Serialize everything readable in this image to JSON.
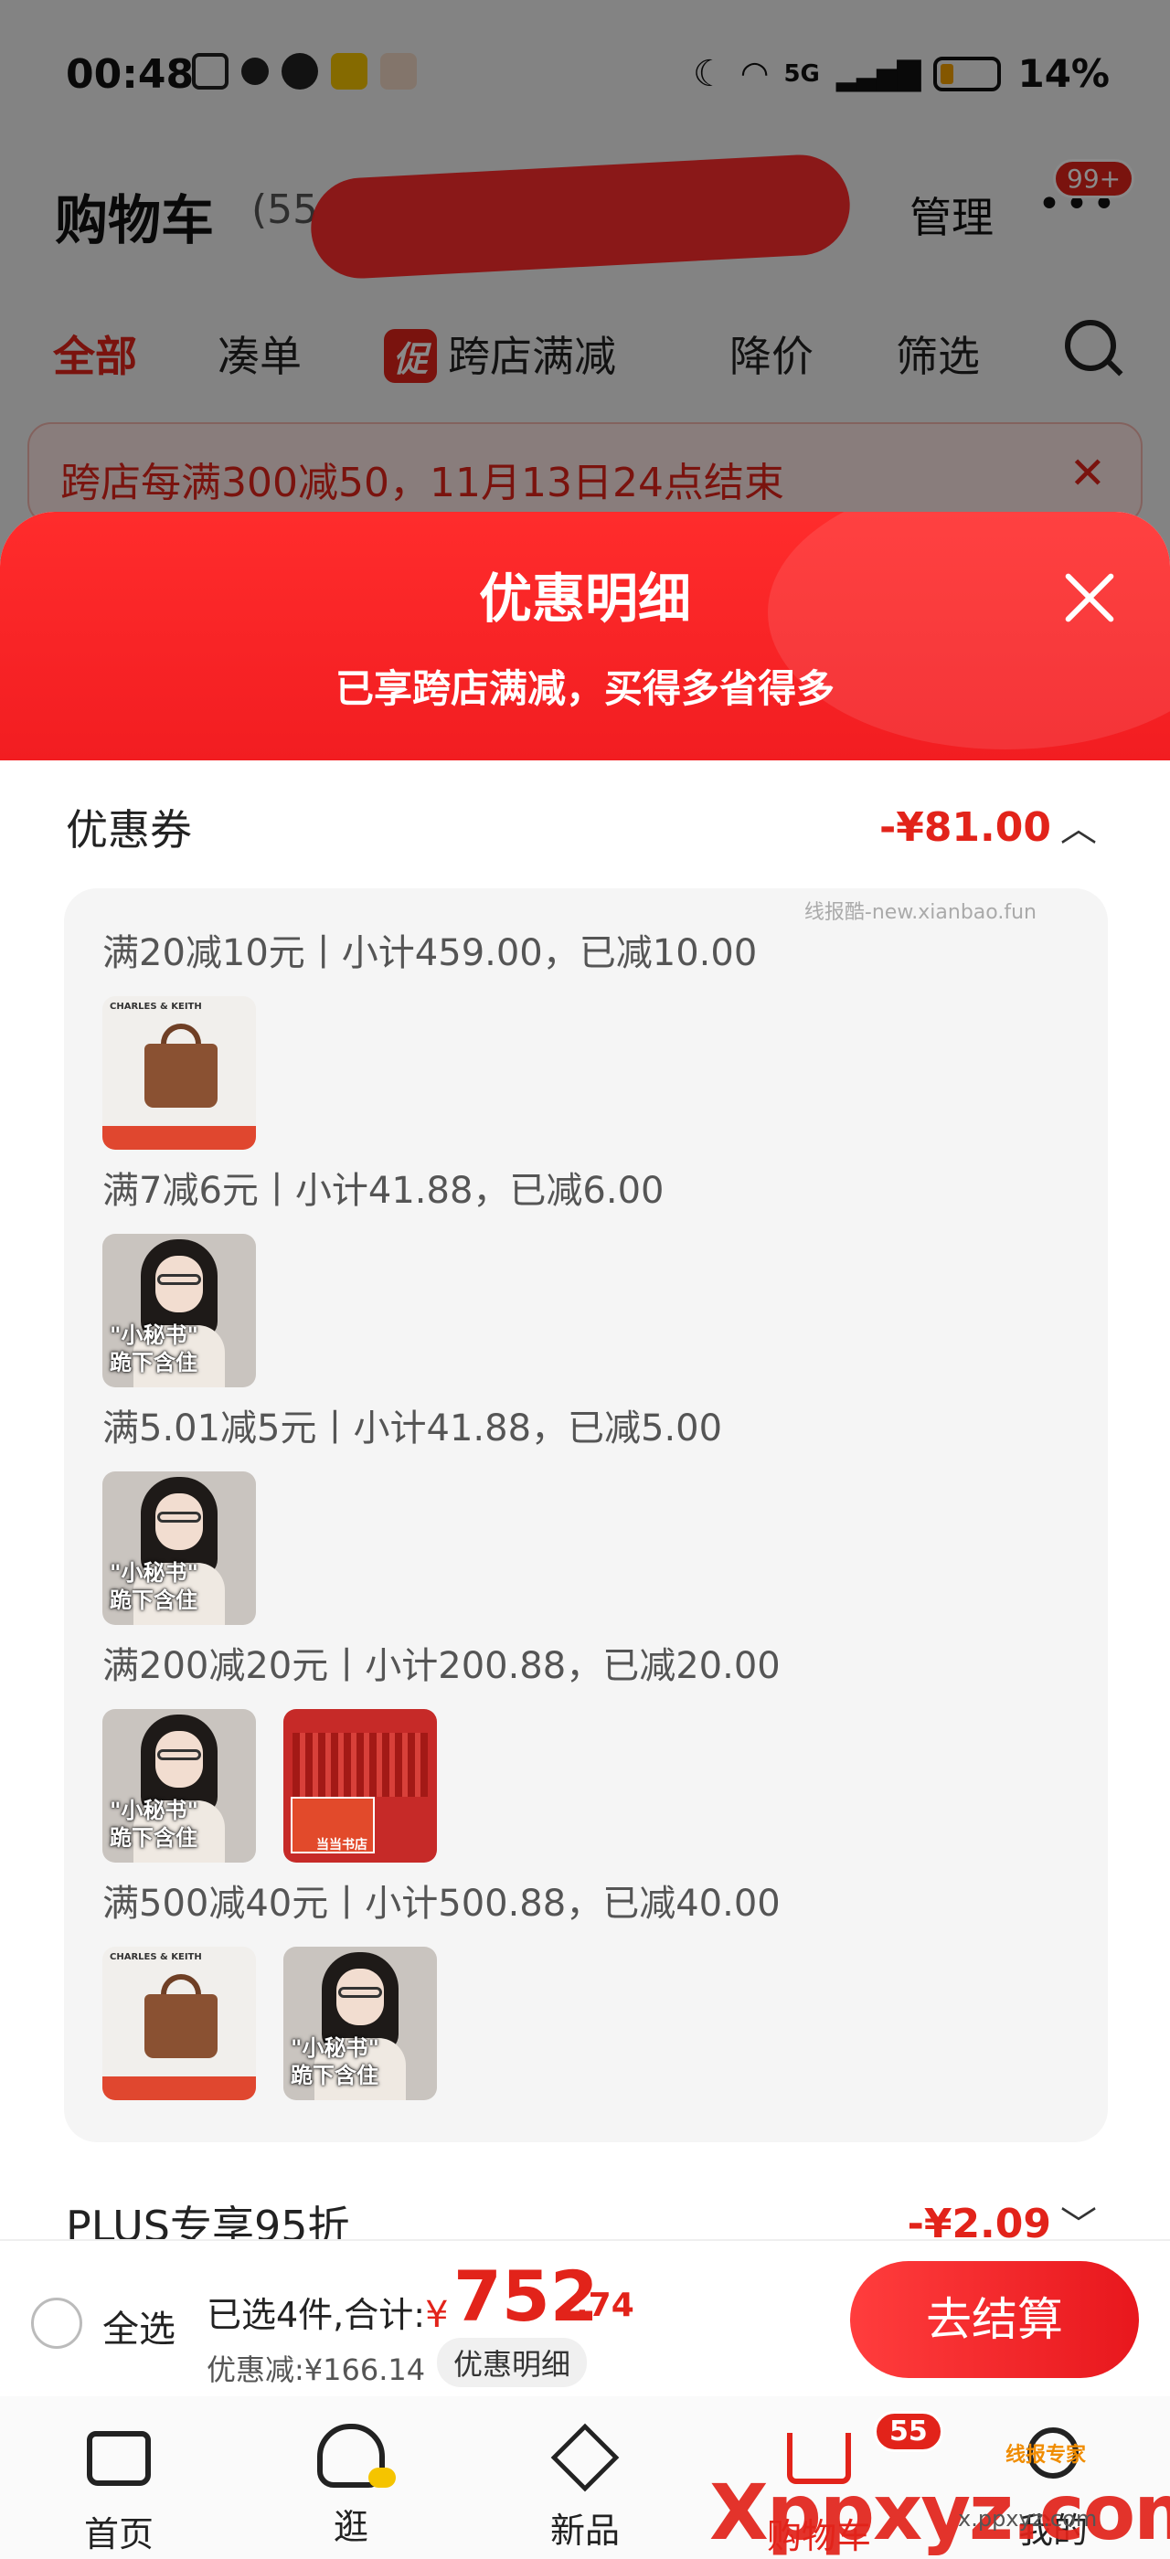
{
  "status": {
    "time": "00:48",
    "network": "5G",
    "battery": "14%"
  },
  "header": {
    "title": "购物车",
    "count": "(55",
    "manage": "管理",
    "more_badge": "99+"
  },
  "tabs": [
    {
      "label": "全部",
      "active": true
    },
    {
      "label": "凑单"
    },
    {
      "label": "跨店满减",
      "tag": "促"
    },
    {
      "label": "降价"
    },
    {
      "label": "筛选"
    }
  ],
  "notice": {
    "text": "跨店每满300减50，11月13日24点结束",
    "close": "✕"
  },
  "sheet": {
    "title": "优惠明细",
    "subtitle": "已享跨店满减，买得多省得多",
    "coupon": {
      "label": "优惠券",
      "amount": "-¥81.00",
      "watermark": "线报酷-new.xianbao.fun",
      "rules": [
        {
          "text": "满20减10元丨小计459.00，已减10.00",
          "thumbs": [
            "bag"
          ]
        },
        {
          "text": "满7减6元丨小计41.88，已减6.00",
          "thumbs": [
            "person"
          ]
        },
        {
          "text": "满5.01减5元丨小计41.88，已减5.00",
          "thumbs": [
            "person"
          ]
        },
        {
          "text": "满200减20元丨小计200.88，已减20.00",
          "thumbs": [
            "person",
            "books"
          ]
        },
        {
          "text": "满500减40元丨小计500.88，已减40.00",
          "thumbs": [
            "bag",
            "person"
          ]
        }
      ]
    },
    "plus": {
      "label": "PLUS专享95折",
      "amount": "-¥2.09"
    }
  },
  "thumb_text": {
    "bag_brand": "CHARLES & KEITH",
    "person_caption": "\"小秘书\"\n跪下含住",
    "books_label": "当当书店"
  },
  "checkout": {
    "select_all": "全选",
    "selected_info": "已选4件,合计:",
    "currency": "¥",
    "total_int": "752",
    "total_dec": ".74",
    "discount": "优惠减:¥166.14",
    "detail_button": "优惠明细",
    "checkout_button": "去结算"
  },
  "tabbar": [
    {
      "label": "首页",
      "icon": "home-icon"
    },
    {
      "label": "逛",
      "icon": "explore-icon"
    },
    {
      "label": "新品",
      "icon": "new-products-icon"
    },
    {
      "label": "购物车",
      "icon": "cart-icon",
      "badge": "55",
      "active": true
    },
    {
      "label": "我的",
      "icon": "profile-icon"
    }
  ],
  "watermark": {
    "logo": "Xppxyz.com",
    "small": "x.ppxyz.com",
    "tag": "线报专家"
  },
  "colors": {
    "accent": "#e2231a",
    "sheet_header": "#f21d21"
  }
}
